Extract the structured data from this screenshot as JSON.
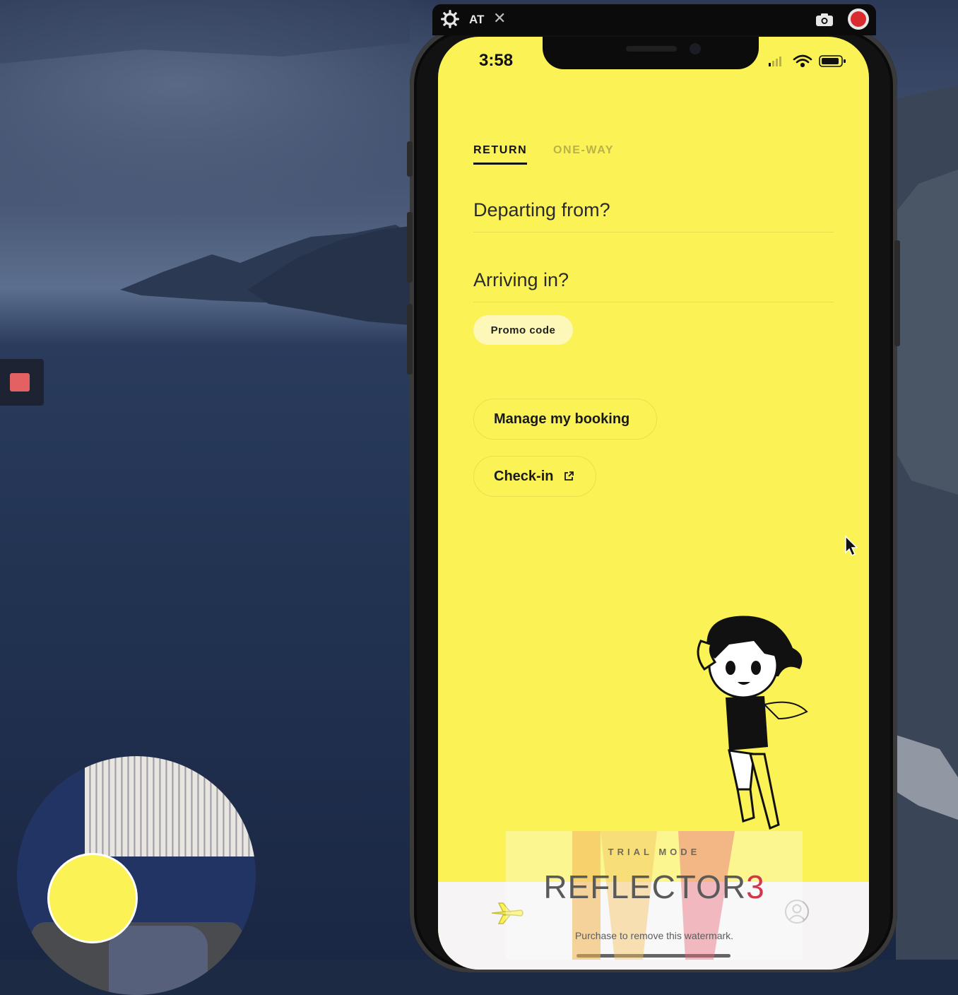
{
  "reflector": {
    "title": "AT",
    "close": "✕",
    "watermark_mode": "TRIAL MODE",
    "watermark_name": "REFLECTOR",
    "watermark_version": "3",
    "watermark_note": "Purchase to remove this watermark."
  },
  "status_bar": {
    "time": "3:58"
  },
  "app": {
    "tabs": [
      {
        "label": "RETURN",
        "active": true
      },
      {
        "label": "ONE-WAY",
        "active": false
      }
    ],
    "departing_placeholder": "Departing from?",
    "arriving_placeholder": "Arriving in?",
    "promo_label": "Promo code",
    "manage_label": "Manage my booking",
    "checkin_label": "Check-in"
  },
  "colors": {
    "app_background": "#fbf255",
    "record": "#d92b2f",
    "accent_three": "#d3354b"
  },
  "icons": [
    "gear-icon",
    "close-icon",
    "camera-icon",
    "record-icon",
    "external-link-icon",
    "plane-icon",
    "profile-icon",
    "cursor-icon"
  ]
}
